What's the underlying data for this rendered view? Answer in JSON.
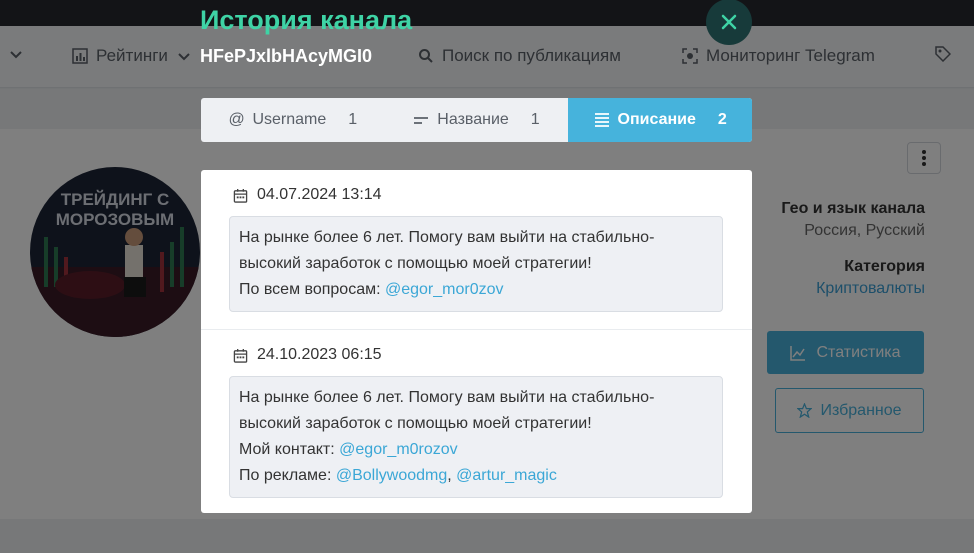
{
  "background": {
    "nav": {
      "ratings_label": "Рейтинги",
      "search_label": "Поиск по публикациям",
      "monitoring_label": "Мониторинг Telegram"
    },
    "channel": {
      "geo_label": "Гео и язык канала",
      "geo_value": "Россия, Русский",
      "category_label": "Категория",
      "category_value": "Криптовалюты",
      "stats_button": "Статистика",
      "favorites_button": "Избранное",
      "avatar_text_line1": "ТРЕЙДИНГ С",
      "avatar_text_line2": "МОРОЗОВЫМ"
    }
  },
  "modal": {
    "title": "История канала",
    "subtitle": "HFePJxlbHAcyMGI0",
    "close_icon": "close-icon",
    "tabs": [
      {
        "icon": "@",
        "label": "Username",
        "count": "1",
        "active": false
      },
      {
        "icon": "short-lines-icon",
        "label": "Название",
        "count": "1",
        "active": false
      },
      {
        "icon": "paragraph-lines-icon",
        "label": "Описание",
        "count": "2",
        "active": true
      }
    ],
    "entries": [
      {
        "date": "04.07.2024 13:14",
        "line1": "На рынке более 6 лет. Помогу вам выйти на стабильно-",
        "line2": "высокий заработок с помощью моей стратегии!",
        "line3_text": "По всем вопросам: ",
        "line3_link": "@egor_mor0zov"
      },
      {
        "date": "24.10.2023 06:15",
        "line1": "На рынке более 6 лет. Помогу вам выйти на стабильно-",
        "line2": "высокий заработок с помощью моей стратегии!",
        "line3_text": "Мой контакт: ",
        "line3_link": "@egor_m0rozov",
        "line4_text": "По рекламе: ",
        "line4_link1": "@Bollywoodmg",
        "line4_sep": ", ",
        "line4_link2": "@artur_magic"
      }
    ]
  },
  "colors": {
    "title_green": "#3ed3a5",
    "active_tab": "#46b3dc",
    "link": "#3ba7d6"
  }
}
